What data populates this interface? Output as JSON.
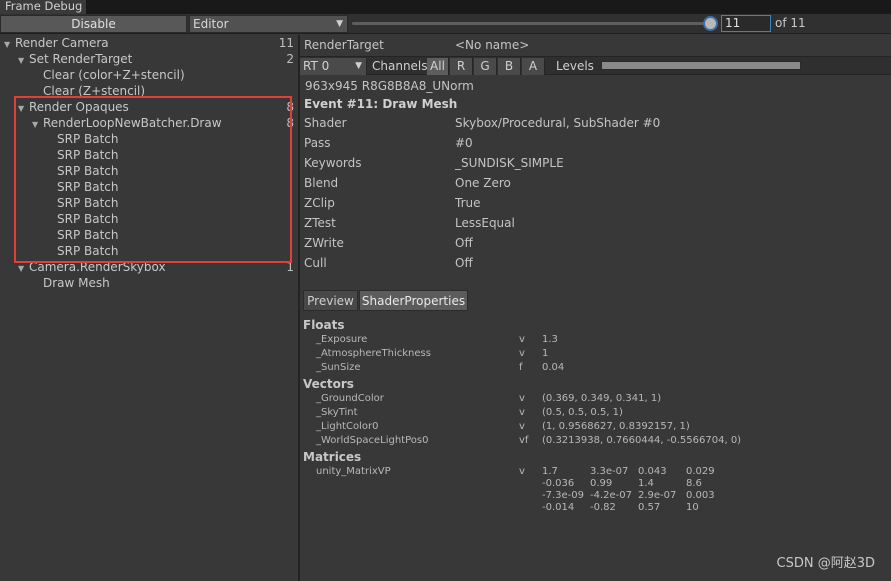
{
  "window": {
    "title": "Frame Debug"
  },
  "toolbar": {
    "disable_label": "Disable",
    "target_select": "Editor",
    "event_value": "11",
    "of_label": "of 11",
    "slider_fraction": 1.0
  },
  "tree": {
    "items": [
      {
        "label": "Render Camera",
        "count": "11",
        "depth": 0,
        "expand": true
      },
      {
        "label": "Set RenderTarget",
        "count": "2",
        "depth": 1,
        "expand": true
      },
      {
        "label": "Clear (color+Z+stencil)",
        "count": "",
        "depth": 2,
        "expand": false
      },
      {
        "label": "Clear (Z+stencil)",
        "count": "",
        "depth": 2,
        "expand": false
      },
      {
        "label": "Render Opaques",
        "count": "8",
        "depth": 1,
        "expand": true
      },
      {
        "label": "RenderLoopNewBatcher.Draw",
        "count": "8",
        "depth": 2,
        "expand": true
      },
      {
        "label": "SRP Batch",
        "count": "",
        "depth": 3,
        "expand": false
      },
      {
        "label": "SRP Batch",
        "count": "",
        "depth": 3,
        "expand": false
      },
      {
        "label": "SRP Batch",
        "count": "",
        "depth": 3,
        "expand": false
      },
      {
        "label": "SRP Batch",
        "count": "",
        "depth": 3,
        "expand": false
      },
      {
        "label": "SRP Batch",
        "count": "",
        "depth": 3,
        "expand": false
      },
      {
        "label": "SRP Batch",
        "count": "",
        "depth": 3,
        "expand": false
      },
      {
        "label": "SRP Batch",
        "count": "",
        "depth": 3,
        "expand": false
      },
      {
        "label": "SRP Batch",
        "count": "",
        "depth": 3,
        "expand": false
      },
      {
        "label": "Camera.RenderSkybox",
        "count": "1",
        "depth": 1,
        "expand": true
      },
      {
        "label": "Draw Mesh",
        "count": "",
        "depth": 2,
        "expand": false
      }
    ]
  },
  "render_target": {
    "label": "RenderTarget",
    "value": "<No name>"
  },
  "rt_bar": {
    "rt_select": "RT 0",
    "channels_label": "Channels",
    "channels": [
      "All",
      "R",
      "G",
      "B",
      "A"
    ],
    "levels_label": "Levels"
  },
  "format": "963x945 R8G8B8A8_UNorm",
  "event_title": "Event #11: Draw Mesh",
  "details": [
    {
      "key": "Shader",
      "value": "Skybox/Procedural, SubShader #0"
    },
    {
      "key": "Pass",
      "value": "#0"
    },
    {
      "key": "Keywords",
      "value": "_SUNDISK_SIMPLE"
    },
    {
      "key": "Blend",
      "value": "One Zero"
    },
    {
      "key": "ZClip",
      "value": "True"
    },
    {
      "key": "ZTest",
      "value": "LessEqual"
    },
    {
      "key": "ZWrite",
      "value": "Off"
    },
    {
      "key": "Cull",
      "value": "Off"
    }
  ],
  "tabs": {
    "preview": "Preview",
    "shader_properties": "ShaderProperties"
  },
  "floats": {
    "title": "Floats",
    "rows": [
      {
        "name": "_Exposure",
        "stage": "v",
        "value": "1.3"
      },
      {
        "name": "_AtmosphereThickness",
        "stage": "v",
        "value": "1"
      },
      {
        "name": "_SunSize",
        "stage": "f",
        "value": "0.04"
      }
    ]
  },
  "vectors": {
    "title": "Vectors",
    "rows": [
      {
        "name": "_GroundColor",
        "stage": "v",
        "value": "(0.369, 0.349, 0.341, 1)"
      },
      {
        "name": "_SkyTint",
        "stage": "v",
        "value": "(0.5, 0.5, 0.5, 1)"
      },
      {
        "name": "_LightColor0",
        "stage": "v",
        "value": "(1, 0.9568627, 0.8392157, 1)"
      },
      {
        "name": "_WorldSpaceLightPos0",
        "stage": "vf",
        "value": "(0.3213938, 0.7660444, -0.5566704, 0)"
      }
    ]
  },
  "matrices": {
    "title": "Matrices",
    "name": "unity_MatrixVP",
    "stage": "v",
    "rows": [
      [
        "1.7",
        "3.3e-07",
        "0.043",
        "0.029"
      ],
      [
        "-0.036",
        "0.99",
        "1.4",
        "8.6"
      ],
      [
        "-7.3e-09",
        "-4.2e-07",
        "2.9e-07",
        "0.003"
      ],
      [
        "-0.014",
        "-0.82",
        "0.57",
        "10"
      ]
    ]
  },
  "watermark": "CSDN @阿赵3D"
}
